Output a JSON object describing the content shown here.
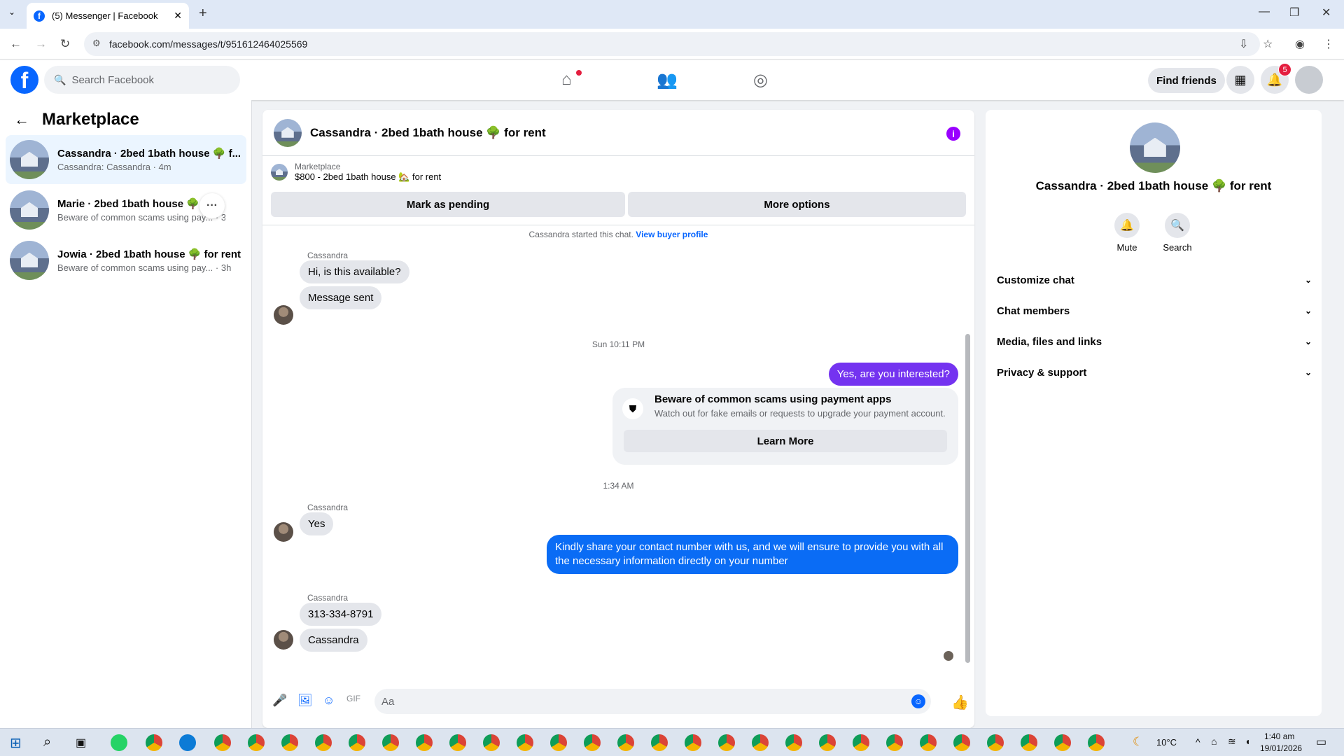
{
  "browser": {
    "tab_title": "(5) Messenger | Facebook",
    "url": "facebook.com/messages/t/951612464025569"
  },
  "fb": {
    "search_placeholder": "Search Facebook",
    "find_friends": "Find friends",
    "notif_count": "5"
  },
  "sidebar": {
    "title": "Marketplace",
    "conversations": [
      {
        "name": "Cassandra · 2bed 1bath house 🌳 f...",
        "sub": "Cassandra: Cassandra · 4m"
      },
      {
        "name": "Marie · 2bed 1bath house 🌳 fo...",
        "sub": "Beware of common scams using pay... · 3h"
      },
      {
        "name": "Jowia · 2bed 1bath house 🌳 for rent",
        "sub": "Beware of common scams using pay... · 3h"
      }
    ]
  },
  "chat": {
    "title": "Cassandra · 2bed 1bath house 🌳 for rent",
    "marketplace_label": "Marketplace",
    "listing": "$800 - 2bed 1bath house 🏡 for rent",
    "mark_pending": "Mark as pending",
    "more_options": "More options",
    "started": "Cassandra started this chat.",
    "view_profile": "View buyer profile",
    "sender": "Cassandra",
    "msg1": "Hi, is this available?",
    "msg2": "Message sent",
    "time1": "Sun 10:11 PM",
    "out1": "Yes, are you interested?",
    "scam_title": "Beware of common scams using payment apps",
    "scam_desc": "Watch out for fake emails or requests to upgrade your payment account.",
    "learn_more": "Learn More",
    "time2": "1:34 AM",
    "msg3": "Yes",
    "out2": "Kindly share your contact number with us, and we will ensure to provide you with all the necessary information directly on your number",
    "msg4": "313-334-8791",
    "msg5": "Cassandra",
    "composer_placeholder": "Aa"
  },
  "right_panel": {
    "name": "Cassandra · 2bed 1bath house 🌳 for rent",
    "mute": "Mute",
    "search": "Search",
    "rows": [
      "Customize chat",
      "Chat members",
      "Media, files and links",
      "Privacy & support"
    ]
  },
  "taskbar": {
    "weather": "10°C",
    "time": "1:40 am",
    "date": "19/01/2026"
  }
}
